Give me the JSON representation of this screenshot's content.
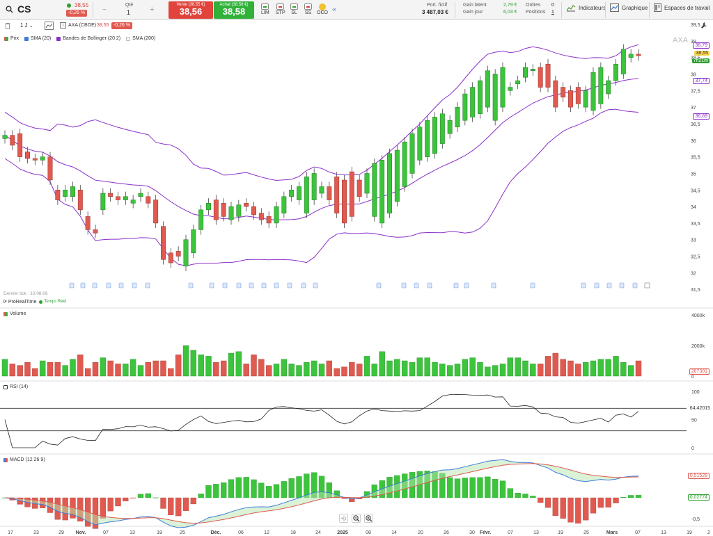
{
  "header": {
    "symbol": "CS",
    "last_price": "38,55",
    "change": "-0,26 %",
    "qty_label": "Qté",
    "qty_value": "1",
    "qty_minus": "−",
    "qty_plus": "+",
    "sell_label": "Vente (38,55 €)",
    "sell_price": "38,56",
    "buy_label": "Achat (38,58 €)",
    "buy_price": "38,58",
    "order_buttons": [
      "LIM",
      "STP",
      "SL",
      "SS",
      "OCO"
    ],
    "collapse_icon": "«",
    "port_label": "Port. fictif",
    "port_value": "3 487,03 €",
    "gain_latent_label": "Gain latent",
    "gain_latent_value": "2,79 €",
    "gain_jour_label": "Gain jour",
    "gain_jour_value": "6,03 €",
    "ordres_label": "Ordres",
    "ordres_value": "0",
    "positions_label": "Positions",
    "positions_value": "1",
    "indicateurs": "Indicateurs",
    "graphique": "Graphique",
    "espaces": "Espaces de travail"
  },
  "toolbar2": {
    "timeframe": "1 J",
    "instrument": "AXA (CBOE)",
    "instrument_price": "38,55",
    "instrument_change": "-0,26 %"
  },
  "legend": [
    {
      "label": "Prix",
      "color": "#e05a50"
    },
    {
      "label": "SMA (20)",
      "color": "#3b7dd8"
    },
    {
      "label": "Bandes de Bollinger (20 2)",
      "color": "#8b2fc9"
    },
    {
      "label": "SMA (200)",
      "color": "#dddddd"
    }
  ],
  "price_panel": {
    "watermark": "AXA",
    "last_tick": "Dernier tick : 10:08:06",
    "realtime": "ProRealTime",
    "realtime_badge": "Temps Réel",
    "axis": [
      "39,5",
      "39",
      "38,5",
      "38",
      "37,5",
      "37",
      "36,5",
      "36",
      "35,5",
      "35",
      "34,5",
      "34",
      "33,5",
      "33",
      "32,5",
      "32",
      "31,5"
    ],
    "tag_upper": "38,79",
    "tag_price": "38,55",
    "tag_time": "7h21m",
    "tag_sma": "37,74",
    "tag_lower": "36,69"
  },
  "volume_panel": {
    "title": "Volume",
    "axis": [
      "4000k",
      "2000k",
      "0"
    ],
    "tag": "267301"
  },
  "rsi_panel": {
    "title": "RSI (14)",
    "axis": [
      "100",
      "50",
      "0"
    ],
    "tag": "64,42015"
  },
  "macd_panel": {
    "title": "MACD (12 26 9)",
    "axis": [
      "0,5",
      "-0,5"
    ],
    "tag1": "0,51528",
    "tag2": "0,02774"
  },
  "xaxis": [
    "17",
    "23",
    "29",
    "Nov.",
    "07",
    "13",
    "19",
    "25",
    "Déc.",
    "06",
    "12",
    "18",
    "24",
    "2025",
    "08",
    "14",
    "20",
    "26",
    "30",
    "Févr.",
    "07",
    "13",
    "19",
    "25",
    "Mars",
    "07",
    "13",
    "19",
    "2"
  ],
  "chart_data": {
    "type": "candlestick",
    "symbol": "AXA",
    "dates": [
      "17",
      "18",
      "21",
      "22",
      "23",
      "24",
      "25",
      "28",
      "29",
      "30",
      "31",
      "Nov.",
      "04",
      "05",
      "06",
      "07",
      "08",
      "11",
      "12",
      "13",
      "14",
      "15",
      "18",
      "19",
      "20",
      "21",
      "22",
      "25",
      "26",
      "27",
      "28",
      "29",
      "Déc.",
      "03",
      "04",
      "05",
      "06",
      "09",
      "10",
      "11",
      "12",
      "13",
      "16",
      "17",
      "18",
      "19",
      "20",
      "23",
      "24",
      "27",
      "30",
      "31",
      "2025",
      "03",
      "06",
      "07",
      "08",
      "09",
      "10",
      "13",
      "14",
      "15",
      "16",
      "17",
      "20",
      "21",
      "22",
      "23",
      "24",
      "27",
      "28",
      "29",
      "30",
      "31",
      "Févr.",
      "04",
      "05",
      "06",
      "07",
      "10",
      "11",
      "12",
      "13",
      "14",
      "17",
      "18",
      "19",
      "20",
      "21",
      "24",
      "25",
      "26",
      "27",
      "28",
      "Mars",
      "04",
      "05",
      "06",
      "07"
    ],
    "open": [
      36.05,
      36.15,
      36.2,
      35.65,
      35.45,
      35.4,
      35.5,
      34.5,
      34.3,
      34.3,
      34.5,
      33.7,
      33.3,
      33.9,
      34.4,
      34.3,
      34.2,
      34.1,
      34.3,
      34.3,
      34.2,
      33.4,
      32.6,
      32.65,
      32.2,
      32.6,
      33.3,
      33.9,
      34.2,
      34.1,
      33.6,
      33.7,
      34.1,
      34.0,
      33.8,
      33.7,
      33.5,
      33.8,
      34.3,
      34.2,
      33.8,
      34.2,
      34.4,
      34.6,
      34.9,
      34.8,
      35.05,
      34.8,
      34.4,
      33.7,
      33.5,
      33.8,
      34.15,
      34.6,
      35.0,
      35.4,
      35.5,
      35.6,
      35.9,
      36.2,
      36.4,
      36.6,
      36.7,
      36.8,
      37.0,
      36.6,
      37.0,
      37.5,
      37.7,
      37.9,
      38.1,
      38.2,
      38.3,
      37.8,
      37.6,
      37.5,
      37.6,
      37.0,
      36.9,
      37.1,
      37.4,
      37.8,
      38.0,
      38.5,
      38.6
    ],
    "close": [
      36.15,
      35.85,
      35.5,
      35.45,
      35.4,
      35.5,
      34.8,
      34.2,
      34.5,
      34.6,
      33.9,
      33.3,
      33.2,
      34.4,
      34.3,
      34.2,
      34.3,
      34.2,
      34.4,
      34.1,
      33.5,
      32.4,
      32.3,
      32.5,
      33.0,
      33.3,
      33.9,
      34.1,
      33.6,
      33.7,
      34.0,
      34.05,
      34.0,
      33.75,
      33.6,
      33.5,
      34.0,
      34.3,
      34.5,
      34.6,
      34.9,
      35.0,
      34.6,
      34.2,
      33.8,
      33.5,
      33.7,
      34.3,
      35.0,
      35.3,
      35.4,
      35.6,
      35.7,
      35.95,
      36.2,
      36.4,
      36.6,
      36.7,
      36.8,
      36.6,
      37.0,
      37.4,
      37.6,
      37.8,
      38.1,
      38.0,
      38.2,
      37.6,
      37.8,
      38.2,
      38.15,
      37.6,
      37.6,
      37.0,
      37.3,
      37.0,
      37.1,
      37.5,
      38.05,
      38.2,
      37.8,
      38.3,
      38.75,
      38.6,
      38.55
    ],
    "ylim": [
      31.5,
      39.5
    ],
    "volume": [
      1100,
      800,
      700,
      900,
      500,
      1000,
      900,
      900,
      700,
      1100,
      1400,
      500,
      900,
      1200,
      1000,
      800,
      800,
      1100,
      700,
      900,
      1000,
      1000,
      500,
      1400,
      2000,
      1700,
      1400,
      1300,
      900,
      1000,
      1500,
      1600,
      800,
      1400,
      1100,
      700,
      800,
      1100,
      800,
      700,
      900,
      1000,
      800,
      1000,
      500,
      600,
      900,
      800,
      1300,
      800,
      1600,
      1000,
      1100,
      1000,
      900,
      1200,
      1200,
      900,
      800,
      700,
      800,
      1100,
      1200,
      900,
      600,
      700,
      800,
      1200,
      1200,
      1000,
      800,
      800,
      1300,
      1500,
      1100,
      1000,
      800,
      900,
      1000,
      1100,
      1100,
      1300,
      900,
      700,
      1000
    ],
    "volume_ylim_k": [
      0,
      4000
    ],
    "rsi_last": 64.42015,
    "macd_last": 0.51528,
    "macd_hist_last": 0.02774
  }
}
